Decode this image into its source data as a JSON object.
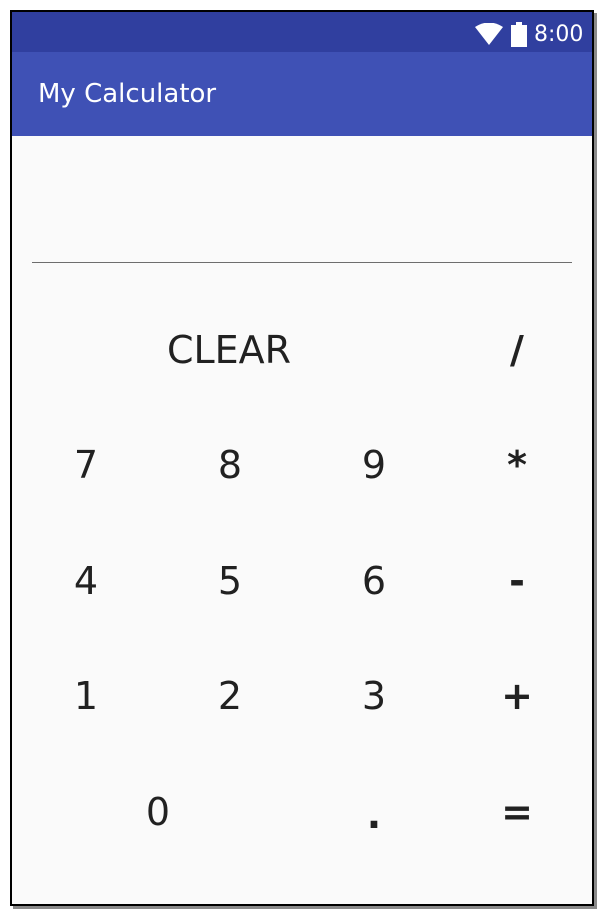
{
  "status_bar": {
    "time": "8:00",
    "wifi_icon": "wifi-icon",
    "battery_icon": "battery-icon"
  },
  "app_bar": {
    "title": "My Calculator"
  },
  "display": {
    "value": ""
  },
  "keypad": {
    "clear": "CLEAR",
    "divide": "/",
    "seven": "7",
    "eight": "8",
    "nine": "9",
    "multiply": "*",
    "four": "4",
    "five": "5",
    "six": "6",
    "subtract": "-",
    "one": "1",
    "two": "2",
    "three": "3",
    "add": "+",
    "zero": "0",
    "decimal": ".",
    "equals": "="
  },
  "colors": {
    "status_bar": "#303f9f",
    "app_bar": "#3f51b5",
    "background": "#fafafa",
    "key_text": "#212121"
  }
}
